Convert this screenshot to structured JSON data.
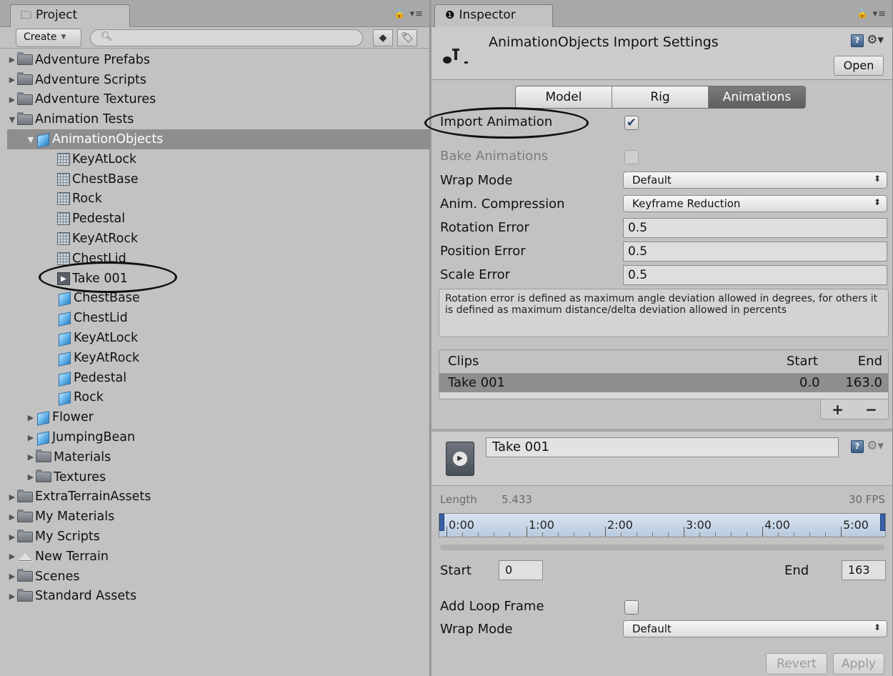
{
  "project": {
    "tab_label": "Project",
    "create_label": "Create",
    "search_placeholder": "",
    "tree": [
      {
        "label": "Adventure Prefabs",
        "depth": 0,
        "icon": "folder-icon",
        "tri": "right"
      },
      {
        "label": "Adventure Scripts",
        "depth": 0,
        "icon": "folder-icon",
        "tri": "right"
      },
      {
        "label": "Adventure Textures",
        "depth": 0,
        "icon": "folder-icon",
        "tri": "right"
      },
      {
        "label": "Animation Tests",
        "depth": 0,
        "icon": "folder-icon",
        "tri": "down"
      },
      {
        "label": "AnimationObjects",
        "depth": 1,
        "icon": "model-icon",
        "tri": "down",
        "selected": true
      },
      {
        "label": "KeyAtLock",
        "depth": 2,
        "icon": "mesh-icon"
      },
      {
        "label": "ChestBase",
        "depth": 2,
        "icon": "mesh-icon"
      },
      {
        "label": "Rock",
        "depth": 2,
        "icon": "mesh-icon"
      },
      {
        "label": "Pedestal",
        "depth": 2,
        "icon": "mesh-icon"
      },
      {
        "label": "KeyAtRock",
        "depth": 2,
        "icon": "mesh-icon"
      },
      {
        "label": "ChestLid",
        "depth": 2,
        "icon": "mesh-icon"
      },
      {
        "label": "Take 001",
        "depth": 2,
        "icon": "animation-clip-icon"
      },
      {
        "label": "ChestBase",
        "depth": 2,
        "icon": "model-icon"
      },
      {
        "label": "ChestLid",
        "depth": 2,
        "icon": "model-icon"
      },
      {
        "label": "KeyAtLock",
        "depth": 2,
        "icon": "model-icon"
      },
      {
        "label": "KeyAtRock",
        "depth": 2,
        "icon": "model-icon"
      },
      {
        "label": "Pedestal",
        "depth": 2,
        "icon": "model-icon"
      },
      {
        "label": "Rock",
        "depth": 2,
        "icon": "model-icon"
      },
      {
        "label": "Flower",
        "depth": 1,
        "icon": "model-icon",
        "tri": "right"
      },
      {
        "label": "JumpingBean",
        "depth": 1,
        "icon": "model-icon",
        "tri": "right"
      },
      {
        "label": "Materials",
        "depth": 1,
        "icon": "folder-icon",
        "tri": "right"
      },
      {
        "label": "Textures",
        "depth": 1,
        "icon": "folder-icon",
        "tri": "right"
      },
      {
        "label": "ExtraTerrainAssets",
        "depth": 0,
        "icon": "folder-icon",
        "tri": "right"
      },
      {
        "label": "My Materials",
        "depth": 0,
        "icon": "folder-icon",
        "tri": "right"
      },
      {
        "label": "My Scripts",
        "depth": 0,
        "icon": "folder-icon",
        "tri": "right"
      },
      {
        "label": "New Terrain",
        "depth": 0,
        "icon": "terrain-icon",
        "tri": "right"
      },
      {
        "label": "Scenes",
        "depth": 0,
        "icon": "folder-icon",
        "tri": "right"
      },
      {
        "label": "Standard Assets",
        "depth": 0,
        "icon": "folder-icon",
        "tri": "right"
      }
    ]
  },
  "inspector": {
    "tab_label": "Inspector",
    "title": "AnimationObjects Import Settings",
    "open_label": "Open",
    "tabs": [
      "Model",
      "Rig",
      "Animations"
    ],
    "active_tab": "Animations",
    "import_animation_label": "Import Animation",
    "import_animation_checked": true,
    "bake_animations_label": "Bake Animations",
    "bake_animations_checked": false,
    "wrap_mode_label": "Wrap Mode",
    "wrap_mode_value": "Default",
    "anim_compression_label": "Anim. Compression",
    "anim_compression_value": "Keyframe Reduction",
    "rotation_error_label": "Rotation Error",
    "rotation_error_value": "0.5",
    "position_error_label": "Position Error",
    "position_error_value": "0.5",
    "scale_error_label": "Scale Error",
    "scale_error_value": "0.5",
    "help_text": "Rotation error is defined as maximum angle deviation allowed in degrees, for others it is defined as maximum distance/delta deviation allowed in percents",
    "clips": {
      "header_clips": "Clips",
      "header_start": "Start",
      "header_end": "End",
      "rows": [
        {
          "name": "Take 001",
          "start": "0.0",
          "end": "163.0"
        }
      ],
      "add_label": "+",
      "remove_label": "−"
    },
    "clip": {
      "name": "Take 001",
      "length_label": "Length",
      "length_value": "5.433",
      "fps": "30 FPS",
      "timeline_ticks": [
        "0:00",
        "1:00",
        "2:00",
        "3:00",
        "4:00",
        "5:00"
      ],
      "start_label": "Start",
      "start_value": "0",
      "end_label": "End",
      "end_value": "163",
      "add_loop_frame_label": "Add Loop Frame",
      "add_loop_frame_checked": false,
      "wrap_mode_label": "Wrap Mode",
      "wrap_mode_value": "Default"
    },
    "revert_label": "Revert",
    "apply_label": "Apply"
  }
}
